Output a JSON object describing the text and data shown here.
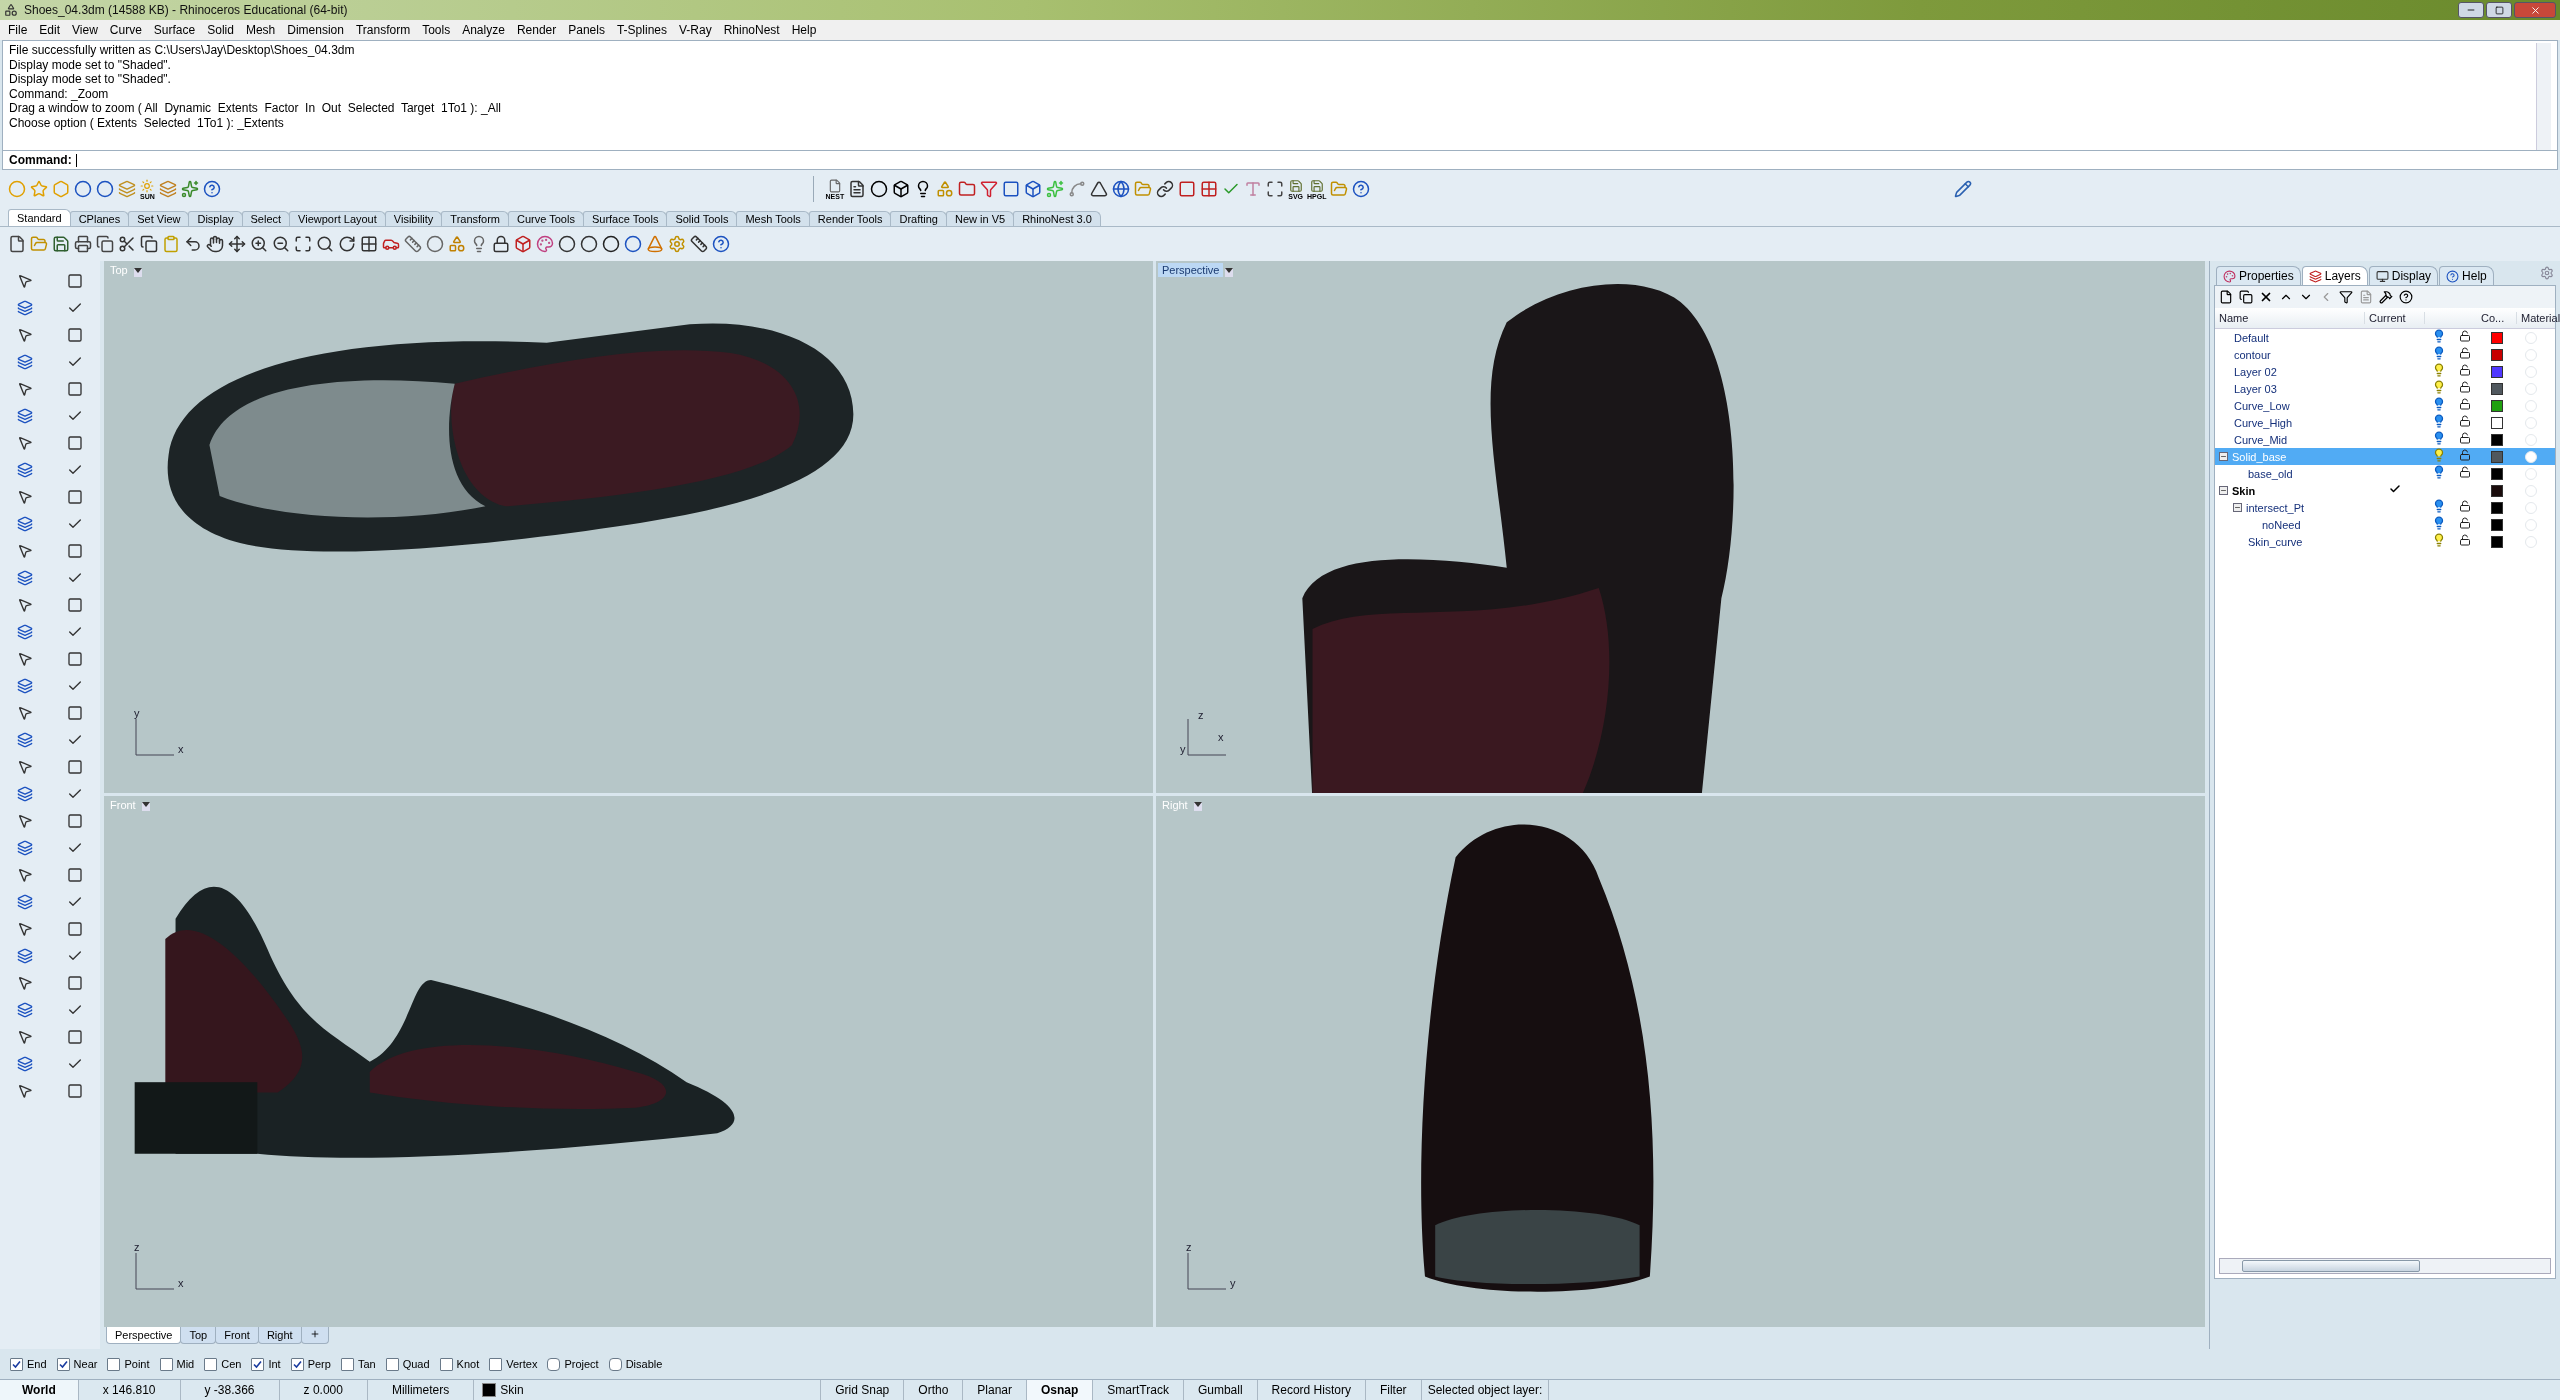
{
  "window": {
    "title": "Shoes_04.3dm (14588 KB) - Rhinoceros Educational (64-bit)"
  },
  "menu": [
    "File",
    "Edit",
    "View",
    "Curve",
    "Surface",
    "Solid",
    "Mesh",
    "Dimension",
    "Transform",
    "Tools",
    "Analyze",
    "Render",
    "Panels",
    "T-Splines",
    "V-Ray",
    "RhinoNest",
    "Help"
  ],
  "command_history": [
    "File successfully written as C:\\Users\\Jay\\Desktop\\Shoes_04.3dm",
    "Display mode set to \"Shaded\".",
    "Display mode set to \"Shaded\".",
    "Command: _Zoom",
    "Drag a window to zoom ( All  Dynamic  Extents  Factor  In  Out  Selected  Target  1To1 ): _All",
    "Choose option ( Extents  Selected  1To1 ): _Extents"
  ],
  "command_prompt": {
    "label": "Command:"
  },
  "top_toolbar": {
    "captions": [
      "SUN",
      "NEST",
      "SVG",
      "HPGL"
    ]
  },
  "toolbar_tabs": [
    {
      "label": "Standard",
      "selected": true
    },
    {
      "label": "CPlanes",
      "selected": false
    },
    {
      "label": "Set View",
      "selected": false
    },
    {
      "label": "Display",
      "selected": false
    },
    {
      "label": "Select",
      "selected": false
    },
    {
      "label": "Viewport Layout",
      "selected": false
    },
    {
      "label": "Visibility",
      "selected": false
    },
    {
      "label": "Transform",
      "selected": false
    },
    {
      "label": "Curve Tools",
      "selected": false
    },
    {
      "label": "Surface Tools",
      "selected": false
    },
    {
      "label": "Solid Tools",
      "selected": false
    },
    {
      "label": "Mesh Tools",
      "selected": false
    },
    {
      "label": "Render Tools",
      "selected": false
    },
    {
      "label": "Drafting",
      "selected": false
    },
    {
      "label": "New in V5",
      "selected": false
    },
    {
      "label": "RhinoNest 3.0",
      "selected": false
    }
  ],
  "viewports": [
    {
      "title": "Top",
      "active": false,
      "axes": [
        "y",
        "x"
      ]
    },
    {
      "title": "Perspective",
      "active": true,
      "axes": [
        "z",
        "y",
        "x"
      ]
    },
    {
      "title": "Front",
      "active": false,
      "axes": [
        "z",
        "x"
      ]
    },
    {
      "title": "Right",
      "active": false,
      "axes": [
        "z",
        "y"
      ]
    }
  ],
  "viewport_tabs": [
    {
      "label": "Perspective",
      "selected": true
    },
    {
      "label": "Top",
      "selected": false
    },
    {
      "label": "Front",
      "selected": false
    },
    {
      "label": "Right",
      "selected": false
    }
  ],
  "panel": {
    "tabs": [
      {
        "label": "Properties",
        "selected": false
      },
      {
        "label": "Layers",
        "selected": true
      },
      {
        "label": "Display",
        "selected": false
      },
      {
        "label": "Help",
        "selected": false
      }
    ],
    "columns": [
      "Name",
      "Current",
      "Co...",
      "Material"
    ],
    "layers": [
      {
        "name": "Default",
        "current": false,
        "visible": true,
        "selected": false,
        "color": "#ff0000"
      },
      {
        "name": "contour",
        "current": false,
        "visible": true,
        "selected": false,
        "color": "#c80000"
      },
      {
        "name": "Layer 02",
        "current": false,
        "visible": false,
        "selected": false,
        "color": "#5038ff"
      },
      {
        "name": "Layer 03",
        "current": false,
        "visible": false,
        "selected": false,
        "color": "#50585e"
      },
      {
        "name": "Curve_Low",
        "current": false,
        "visible": true,
        "selected": false,
        "color": "#20a010"
      },
      {
        "name": "Curve_High",
        "current": false,
        "visible": true,
        "selected": false,
        "color": "#ffffff"
      },
      {
        "name": "Curve_Mid",
        "current": false,
        "visible": true,
        "selected": false,
        "color": "#000000"
      },
      {
        "name": "Solid_base",
        "current": false,
        "visible": false,
        "selected": true,
        "color": "#50585e",
        "expanded": true,
        "children": [
          {
            "name": "base_old",
            "current": false,
            "visible": true,
            "selected": false,
            "color": "#000000"
          }
        ]
      },
      {
        "name": "Skin",
        "current": true,
        "selected": false,
        "color": "#1a0c0c",
        "expanded": true,
        "children": [
          {
            "name": "intersect_Pt",
            "current": false,
            "visible": true,
            "selected": false,
            "color": "#000000",
            "expanded": true,
            "children": [
              {
                "name": "noNeed",
                "current": false,
                "visible": true,
                "selected": false,
                "color": "#000000"
              }
            ]
          },
          {
            "name": "Skin_curve",
            "current": false,
            "visible": false,
            "selected": false,
            "color": "#000000"
          }
        ]
      }
    ]
  },
  "osnaps": [
    {
      "label": "End",
      "checked": true,
      "kind": "snap"
    },
    {
      "label": "Near",
      "checked": true,
      "kind": "snap"
    },
    {
      "label": "Point",
      "checked": false,
      "kind": "snap"
    },
    {
      "label": "Mid",
      "checked": false,
      "kind": "snap"
    },
    {
      "label": "Cen",
      "checked": false,
      "kind": "snap"
    },
    {
      "label": "Int",
      "checked": true,
      "kind": "snap"
    },
    {
      "label": "Perp",
      "checked": true,
      "kind": "snap"
    },
    {
      "label": "Tan",
      "checked": false,
      "kind": "snap"
    },
    {
      "label": "Quad",
      "checked": false,
      "kind": "snap"
    },
    {
      "label": "Knot",
      "checked": false,
      "kind": "snap"
    },
    {
      "label": "Vertex",
      "checked": false,
      "kind": "snap"
    },
    {
      "label": "Project",
      "checked": false,
      "kind": "option"
    },
    {
      "label": "Disable",
      "checked": false,
      "kind": "option"
    }
  ],
  "status_bar": [
    {
      "kind": "readout",
      "text": "World"
    },
    {
      "kind": "readout",
      "text": "x 146.810"
    },
    {
      "kind": "readout",
      "text": "y -38.366"
    },
    {
      "kind": "readout",
      "text": "z 0.000"
    },
    {
      "kind": "readout",
      "text": "Millimeters"
    },
    {
      "kind": "layer",
      "text": "Skin",
      "color": "#000000"
    },
    {
      "kind": "toggle",
      "text": "Grid Snap",
      "on": false
    },
    {
      "kind": "toggle",
      "text": "Ortho",
      "on": false
    },
    {
      "kind": "toggle",
      "text": "Planar",
      "on": false
    },
    {
      "kind": "toggle",
      "text": "Osnap",
      "on": true
    },
    {
      "kind": "toggle",
      "text": "SmartTrack",
      "on": false
    },
    {
      "kind": "toggle",
      "text": "Gumball",
      "on": false
    },
    {
      "kind": "toggle",
      "text": "Record History",
      "on": false
    },
    {
      "kind": "toggle",
      "text": "Filter",
      "on": false
    },
    {
      "kind": "message",
      "text": "Selected object layer:"
    }
  ]
}
